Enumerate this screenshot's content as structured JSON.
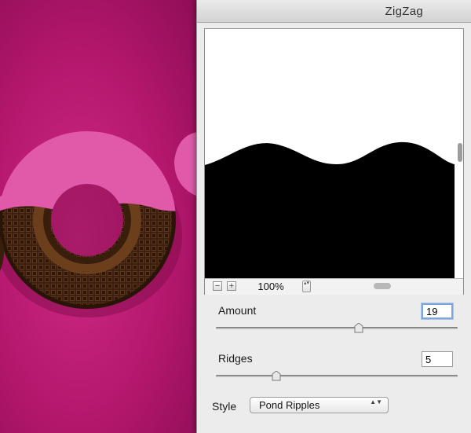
{
  "dialog": {
    "title": "ZigZag"
  },
  "preview": {
    "zoom_out_label": "−",
    "zoom_in_label": "+",
    "zoom_value": "100%",
    "zoom_stepper_label": "▴▾"
  },
  "controls": {
    "amount": {
      "label": "Amount",
      "value": "19",
      "slider_fraction": 0.59
    },
    "ridges": {
      "label": "Ridges",
      "value": "5",
      "slider_fraction": 0.25
    },
    "style": {
      "label": "Style",
      "selected": "Pond Ripples",
      "arrows": "▲▼"
    }
  },
  "colors": {
    "canvas_background": "#c01d76",
    "icing_pink": "#e05aa9",
    "chocolate": "#4a2a14",
    "preview_black": "#000000",
    "focus_ring": "#7aa7dc"
  }
}
